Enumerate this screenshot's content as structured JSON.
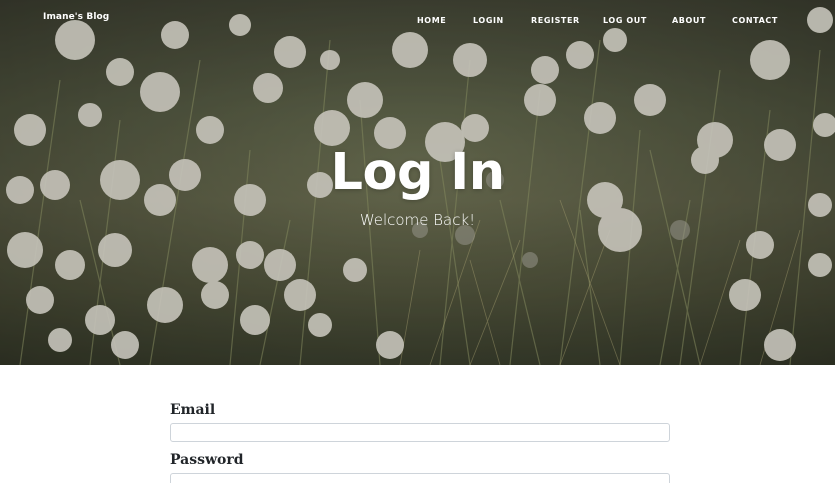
{
  "navbar": {
    "brand": "Imane's Blog",
    "items": [
      {
        "id": "home",
        "label": "HOME"
      },
      {
        "id": "login",
        "label": "LOGIN"
      },
      {
        "id": "register",
        "label": "REGISTER"
      },
      {
        "id": "logout",
        "label": "LOG OUT"
      },
      {
        "id": "about",
        "label": "ABOUT"
      },
      {
        "id": "contact",
        "label": "CONTACT"
      }
    ]
  },
  "header": {
    "title": "Log In",
    "subtitle": "Welcome Back!"
  },
  "form": {
    "email_label": "Email",
    "email_value": "",
    "password_label": "Password",
    "password_value": ""
  },
  "colors": {
    "text_dark": "#212529",
    "input_border": "#ced4da"
  }
}
